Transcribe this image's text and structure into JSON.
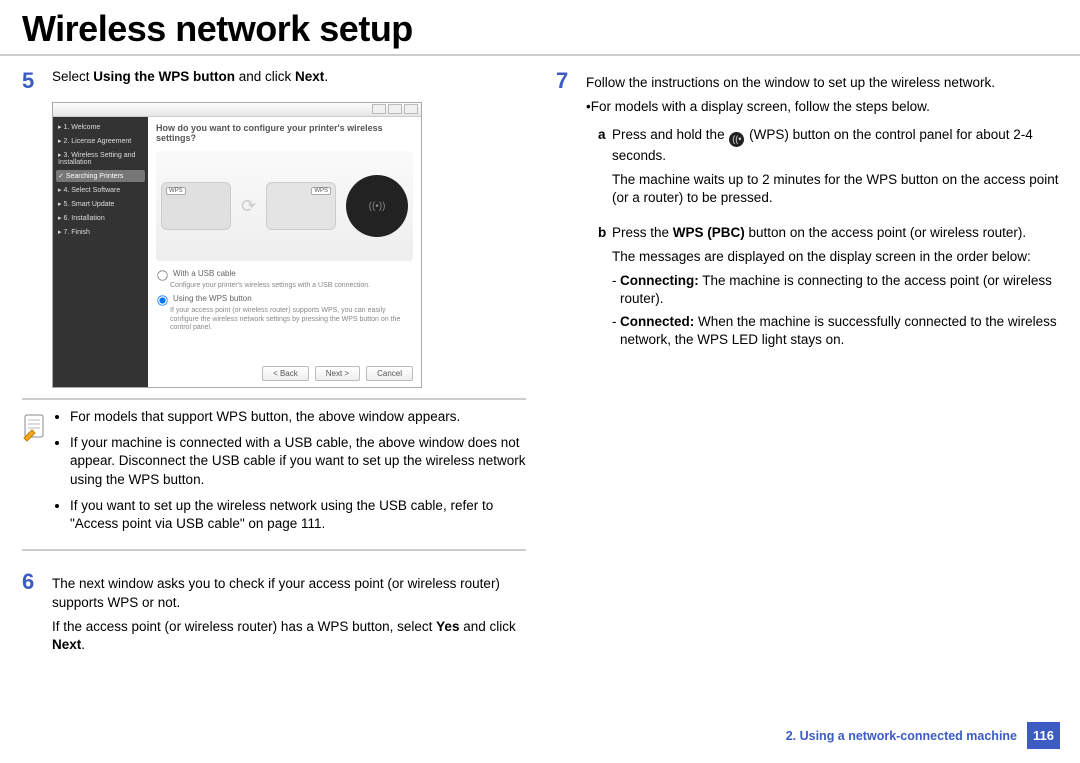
{
  "title": "Wireless network setup",
  "left": {
    "step5": {
      "num": "5",
      "pre": "Select ",
      "bold1": "Using the WPS button",
      "mid": " and click ",
      "bold2": "Next",
      "post": "."
    },
    "installer": {
      "question": "How do you want to configure your printer's wireless settings?",
      "side": [
        "1. Welcome",
        "2. License Agreement",
        "3. Wireless Setting and Installation",
        "Searching Printers",
        "4. Select Software",
        "5. Smart Update",
        "6. Installation",
        "7. Finish"
      ],
      "wps_badge": "WPS",
      "opt1_label": "With a USB cable",
      "opt1_desc": "Configure your printer's wireless settings with a USB connection.",
      "opt2_label": "Using the WPS button",
      "opt2_desc": "If your access point (or wireless router) supports WPS, you can easily configure the wireless network settings by pressing the WPS button on the control panel.",
      "btn_back": "< Back",
      "btn_next": "Next >",
      "btn_cancel": "Cancel"
    },
    "note": {
      "b1": "For models that support WPS button, the above window appears.",
      "b2": "If your machine is connected with a USB cable, the above window does not appear. Disconnect the USB cable if you want to set up the wireless network using the WPS button.",
      "b3": "If you want to set up the wireless network using the USB cable, refer to \"Access point via USB cable\" on page 111."
    },
    "step6": {
      "num": "6",
      "p1": "The next window asks you to check if your access point (or wireless router) supports WPS or not.",
      "p2_pre": "If the access point (or wireless router) has a WPS button, select ",
      "p2_b1": "Yes",
      "p2_mid": " and click ",
      "p2_b2": "Next",
      "p2_post": "."
    }
  },
  "right": {
    "step7": {
      "num": "7",
      "p1": "Follow the instructions on the window to set up the wireless network.",
      "sub1": "•For models with a display screen, follow the steps below.",
      "a": {
        "mark": "a",
        "pre": "Press and hold the ",
        "post": " (WPS) button on the control panel for about 2-4 seconds.",
        "p2": "The machine waits up to 2 minutes for the WPS button on the access point (or a router) to be pressed."
      },
      "b": {
        "mark": "b",
        "pre": "Press the ",
        "bold": "WPS (PBC)",
        "post": " button on the access point (or wireless router).",
        "p2": "The messages are displayed on the display screen in the order below:",
        "d1_b": "Connecting:",
        "d1_t": " The machine is connecting to the access point (or wireless router).",
        "d2_b": "Connected:",
        "d2_t": " When the machine is successfully connected to the wireless network, the WPS LED light stays on."
      }
    }
  },
  "footer": {
    "chapter": "2.  Using a network-connected machine",
    "page": "116"
  }
}
